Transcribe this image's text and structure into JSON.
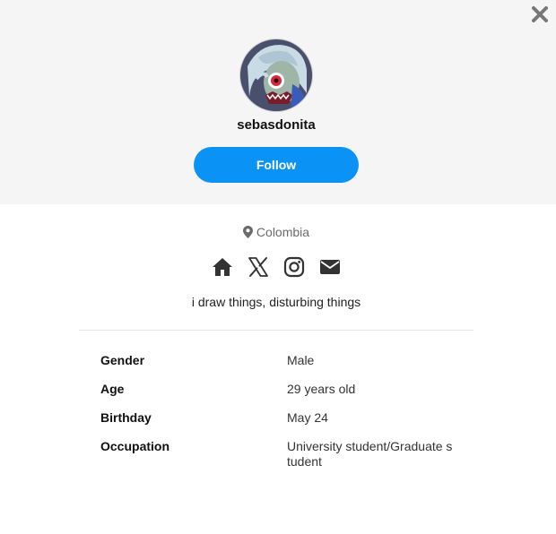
{
  "profile": {
    "username": "sebasdonita",
    "follow_label": "Follow",
    "location": "Colombia",
    "bio": "i draw things, disturbing things"
  },
  "social_icons": [
    "home-icon",
    "x-icon",
    "instagram-icon",
    "mail-icon"
  ],
  "info": [
    {
      "label": "Gender",
      "value": "Male"
    },
    {
      "label": "Age",
      "value": "29 years old"
    },
    {
      "label": "Birthday",
      "value": "May 24"
    },
    {
      "label": "Occupation",
      "value": "University student/Graduate student"
    }
  ],
  "colors": {
    "accent": "#0a93f5",
    "header_bg": "#f5f5f5",
    "icon": "#333333",
    "muted": "#6b6b6b"
  }
}
